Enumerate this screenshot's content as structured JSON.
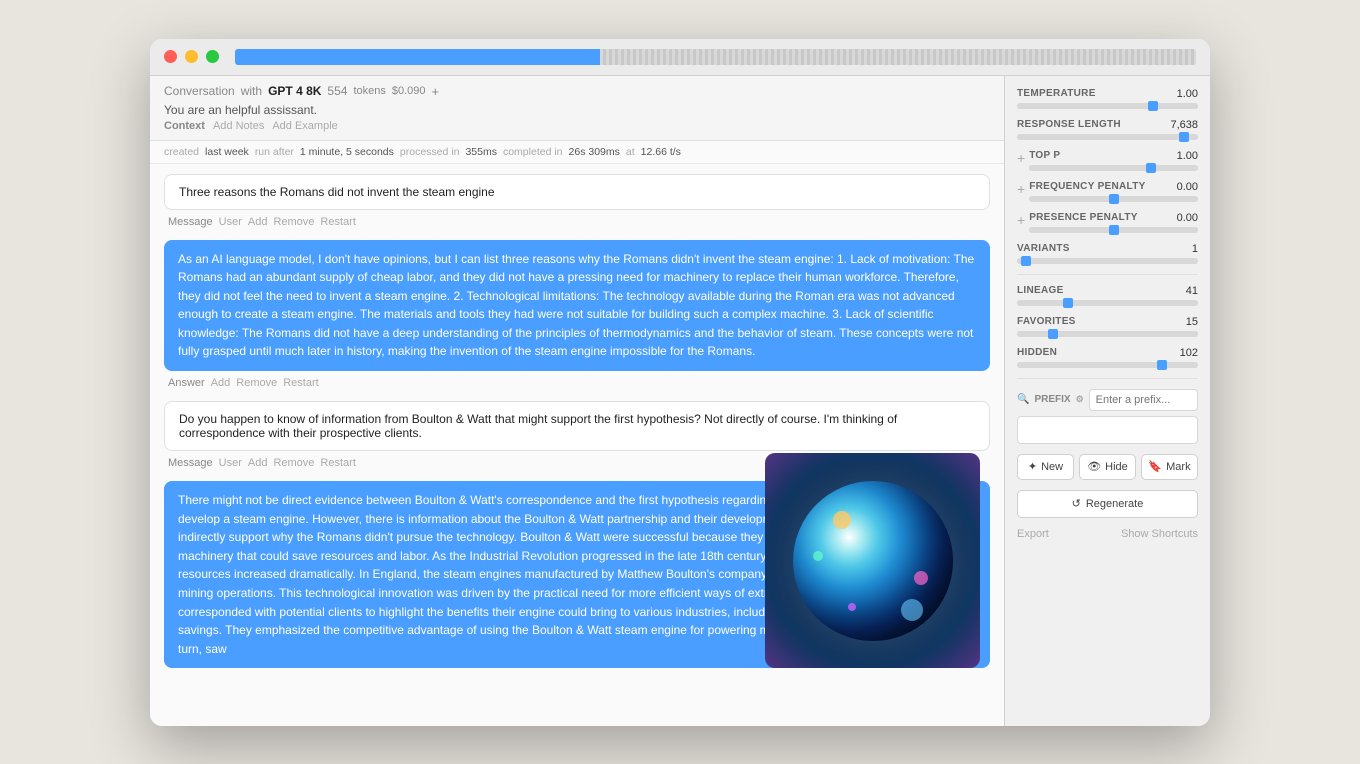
{
  "window": {
    "titlebar": {
      "traffic_lights": [
        "red",
        "yellow",
        "green"
      ]
    }
  },
  "header": {
    "conversation_label": "Conversation",
    "with_label": "with",
    "model": "GPT 4 8K",
    "tokens_count": "554",
    "tokens_label": "tokens",
    "cost": "$0.090",
    "system_prompt": "You are an helpful assissant.",
    "context_label": "Context",
    "add_notes": "Add Notes",
    "add_example": "Add Example"
  },
  "chat_meta": {
    "created_label": "created",
    "created_time": "last week",
    "run_after_label": "run after",
    "run_after_value": "1 minute, 5 seconds",
    "processed_label": "processed in",
    "processed_value": "355ms",
    "completed_label": "completed in",
    "completed_value": "26s 309ms",
    "at_label": "at",
    "speed_value": "12.66 t/s"
  },
  "messages": [
    {
      "id": "msg1",
      "type": "user",
      "text": "Three reasons the Romans did not invent the steam engine",
      "meta_type": "Message",
      "meta_user": "User",
      "actions": [
        "Add",
        "Remove",
        "Restart"
      ]
    },
    {
      "id": "msg2",
      "type": "assistant",
      "text": "As an AI language model, I don't have opinions, but I can list three reasons why the Romans didn't invent the steam engine:\n1. Lack of motivation: The Romans had an abundant supply of cheap labor, and they did not have a pressing need for machinery to replace their human workforce. Therefore, they did not feel the need to invent a steam engine.\n2. Technological limitations: The technology available during the Roman era was not advanced enough to create a steam engine. The materials and tools they had were not suitable for building such a complex machine.\n3. Lack of scientific knowledge: The Romans did not have a deep understanding of the principles of thermodynamics and the behavior of steam. These concepts were not fully grasped until much later in history, making the invention of the steam engine impossible for the Romans.",
      "meta_type": "Answer",
      "actions": [
        "Add",
        "Remove",
        "Restart"
      ]
    },
    {
      "id": "msg3",
      "type": "user",
      "text": "Do you happen to know of information from Boulton & Watt that might support the first hypothesis? Not directly of course. I'm thinking of correspondence with their prospective clients.",
      "meta_type": "Message",
      "meta_user": "User",
      "actions": [
        "Add",
        "Remove",
        "Restart"
      ]
    },
    {
      "id": "msg4",
      "type": "assistant",
      "text": "There might not be direct evidence between Boulton & Watt's correspondence and the first hypothesis regarding the Romans' lack of motivation to develop a steam engine. However, there is information about the Boulton & Watt partnership and their development of the steam engine, which might indirectly support why the Romans didn't pursue the technology.\nBoulton & Watt were successful because they recognized a need for efficient machinery that could save resources and labor. As the Industrial Revolution progressed in the late 18th century, the demand for coal and other resources increased dramatically. In England, the steam engines manufactured by Matthew Boulton's company significantly improved the efficiency of mining operations. This technological innovation was driven by the practical need for more efficient ways of extracting coal.\nBoulton & Watt often corresponded with potential clients to highlight the benefits their engine could bring to various industries, including improved efficiency and cost savings. They emphasized the competitive advantage of using the Boulton & Watt steam engine for powering mills, factories, and other industries, in turn, saw",
      "meta_type": "Answer",
      "actions": [
        "Add",
        "Remove",
        "Restart"
      ]
    }
  ],
  "sidebar": {
    "temperature_label": "TEMPERATURE",
    "temperature_value": "1.00",
    "temperature_pct": 75,
    "response_length_label": "RESPONSE LENGTH",
    "response_length_value": "7,638",
    "response_length_pct": 90,
    "top_p_label": "TOP P",
    "top_p_value": "1.00",
    "top_p_pct": 72,
    "frequency_penalty_label": "FREQUENCY PENALTY",
    "frequency_penalty_value": "0.00",
    "frequency_penalty_pct": 50,
    "presence_penalty_label": "PRESENCE PENALTY",
    "presence_penalty_value": "0.00",
    "presence_penalty_pct": 50,
    "variants_label": "VARIANTS",
    "variants_value": "1",
    "variants_pct": 5,
    "lineage_label": "LINEAGE",
    "lineage_value": "41",
    "lineage_pct": 28,
    "favorites_label": "FAVORITES",
    "favorites_value": "15",
    "favorites_pct": 20,
    "hidden_label": "HIDDEN",
    "hidden_value": "102",
    "hidden_pct": 80,
    "prefix_label": "PREFIX",
    "prefix_placeholder": "Enter a prefix...",
    "new_btn": "New",
    "hide_btn": "Hide",
    "mark_btn": "Mark",
    "regenerate_btn": "Regenerate",
    "export_link": "Export",
    "shortcuts_link": "Show Shortcuts"
  }
}
